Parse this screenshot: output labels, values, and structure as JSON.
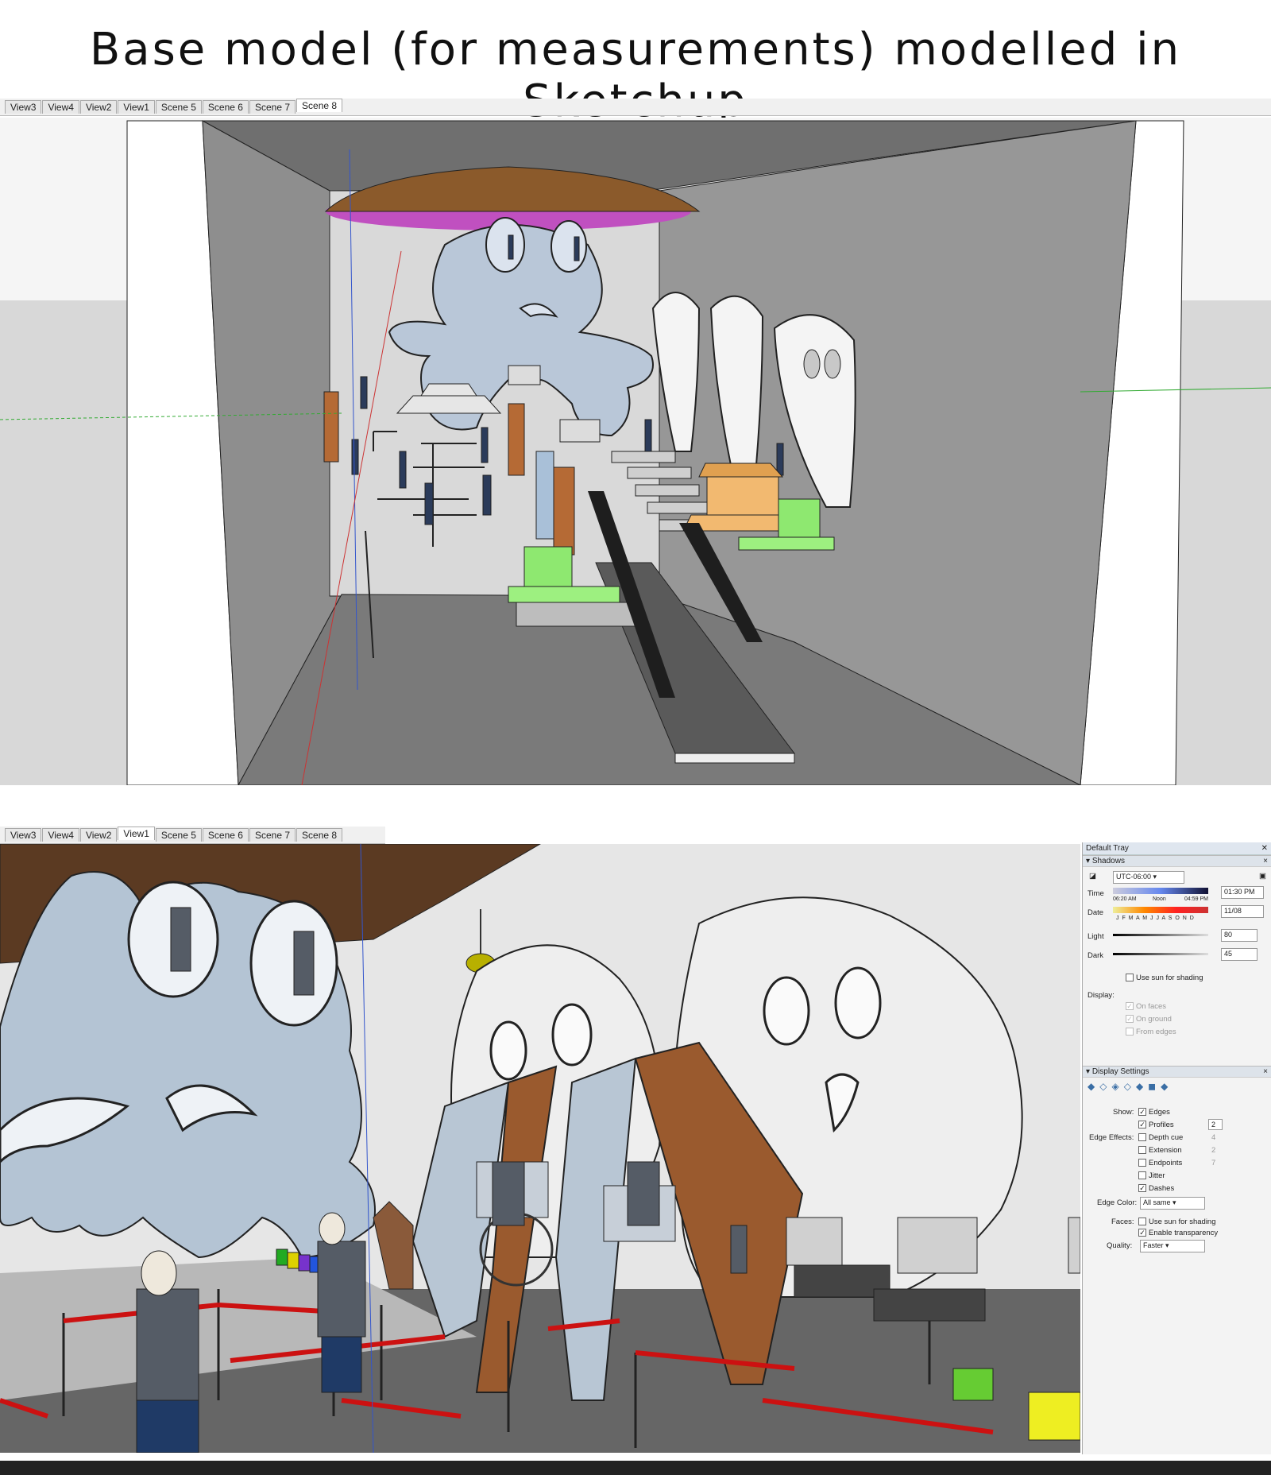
{
  "title": "Base model (for measurements) modelled in Sketchup",
  "top_panel": {
    "tabs": [
      "View3",
      "View4",
      "View2",
      "View1",
      "Scene 5",
      "Scene 6",
      "Scene 7",
      "Scene 8"
    ],
    "active_tab": "Scene 8"
  },
  "bottom_panel": {
    "tabs": [
      "View3",
      "View4",
      "View2",
      "View1",
      "Scene 5",
      "Scene 6",
      "Scene 7",
      "Scene 8"
    ],
    "active_tab": "View1"
  },
  "tray": {
    "title": "Default Tray",
    "shadows": {
      "header": "Shadows",
      "timezone": "UTC-06:00",
      "time_label": "Time",
      "time_start": "06:20 AM",
      "time_noon": "Noon",
      "time_end": "04:59 PM",
      "time_value": "01:30 PM",
      "date_label": "Date",
      "months": "J F M A M J J A S O N D",
      "date_value": "11/08",
      "light_label": "Light",
      "light_value": "80",
      "dark_label": "Dark",
      "dark_value": "45",
      "use_sun": "Use sun for shading",
      "display_label": "Display:",
      "on_faces": "On faces",
      "on_ground": "On ground",
      "from_edges": "From edges"
    },
    "display_settings": {
      "header": "Display Settings",
      "show_label": "Show:",
      "edges": "Edges",
      "profiles": "Profiles",
      "profiles_value": "2",
      "edge_effects_label": "Edge Effects:",
      "depth_cue": "Depth cue",
      "depth_cue_value": "4",
      "extension": "Extension",
      "extension_value": "2",
      "endpoints": "Endpoints",
      "endpoints_value": "7",
      "jitter": "Jitter",
      "dashes": "Dashes",
      "edge_color_label": "Edge Color:",
      "edge_color_value": "All same",
      "faces_label": "Faces:",
      "faces_use_sun": "Use sun for shading",
      "enable_transparency": "Enable transparency",
      "quality_label": "Quality:",
      "quality_value": "Faster"
    }
  }
}
